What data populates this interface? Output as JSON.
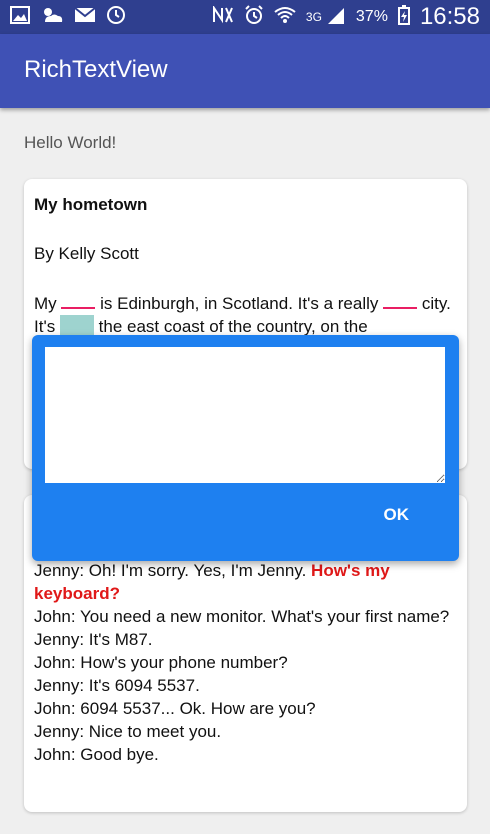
{
  "status_bar": {
    "battery_percent": "37%",
    "time": "16:58",
    "network": "3G"
  },
  "app": {
    "title": "RichTextView"
  },
  "main": {
    "hello_text": "Hello World!",
    "card1": {
      "title": "My hometown",
      "byline": "By Kelly Scott",
      "p1": "My",
      "p2": "is Edinburgh, in Scotland. It's a really",
      "p3": "city. It's",
      "p4": "the east coast of the country, on the"
    },
    "card2": {
      "line1": "Jenny: Oh! I'm sorry. Yes, I'm Jenny.",
      "line1_red": "How's my keyboard?",
      "line2": "John: You need a new monitor. What's your first name?",
      "line3": "Jenny: It's M87.",
      "line4": "John: How's your phone number?",
      "line5": "Jenny: It's 6094 5537.",
      "line6": "John: 6094 5537... Ok. How are you?",
      "line7": "Jenny: Nice to meet you.",
      "line8": "John: Good bye."
    }
  },
  "dialog": {
    "ok_label": "OK",
    "input_value": ""
  },
  "colors": {
    "status_bar": "#2f3f8f",
    "app_bar": "#3f51b5",
    "dialog": "#1e80f0",
    "highlight_red": "#e01818",
    "blank_pink": "#e91e63",
    "blank_teal": "#9ed3cf"
  }
}
